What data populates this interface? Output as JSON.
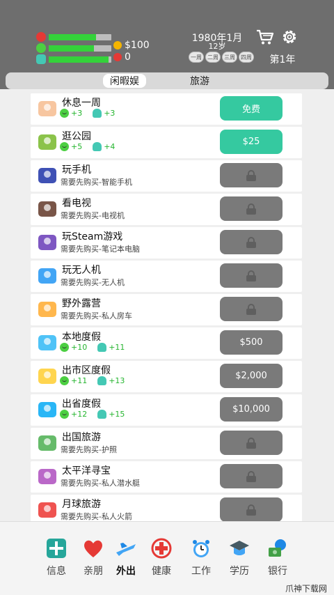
{
  "header": {
    "money": "$100",
    "karma": "0",
    "date": "1980年1月",
    "age": "12岁",
    "weeks": [
      "一周",
      "二周",
      "三周",
      "四周"
    ],
    "year": "第1年",
    "bars": {
      "health": 0.76,
      "happiness": 0.72,
      "smarts": 0.96
    },
    "icons": [
      "heart-icon",
      "face-icon",
      "head-icon",
      "cart-icon",
      "gear-icon",
      "coin-icon"
    ]
  },
  "tabs": [
    "闲暇娱",
    "旅游"
  ],
  "items": [
    {
      "title": "休息一周",
      "sub": "",
      "happy": "+3",
      "smart": "+3",
      "action": "免费",
      "state": "teal"
    },
    {
      "title": "逛公园",
      "sub": "",
      "happy": "+5",
      "smart": "+4",
      "action": "$25",
      "state": "teal"
    },
    {
      "title": "玩手机",
      "sub": "需要先购买-智能手机",
      "happy": "",
      "smart": "",
      "action": "",
      "state": "locked"
    },
    {
      "title": "看电视",
      "sub": "需要先购买-电视机",
      "happy": "",
      "smart": "",
      "action": "",
      "state": "locked"
    },
    {
      "title": "玩Steam游戏",
      "sub": "需要先购买-笔记本电脑",
      "happy": "",
      "smart": "",
      "action": "",
      "state": "locked"
    },
    {
      "title": "玩无人机",
      "sub": "需要先购买-无人机",
      "happy": "",
      "smart": "",
      "action": "",
      "state": "locked"
    },
    {
      "title": "野外露营",
      "sub": "需要先购买-私人房车",
      "happy": "",
      "smart": "",
      "action": "",
      "state": "locked"
    },
    {
      "title": "本地度假",
      "sub": "",
      "happy": "+10",
      "smart": "+11",
      "action": "$500",
      "state": "gray"
    },
    {
      "title": "出市区度假",
      "sub": "",
      "happy": "+11",
      "smart": "+13",
      "action": "$2,000",
      "state": "gray"
    },
    {
      "title": "出省度假",
      "sub": "",
      "happy": "+12",
      "smart": "+15",
      "action": "$10,000",
      "state": "gray"
    },
    {
      "title": "出国旅游",
      "sub": "需要先购买-护照",
      "happy": "",
      "smart": "",
      "action": "",
      "state": "locked"
    },
    {
      "title": "太平洋寻宝",
      "sub": "需要先购买-私人潜水艇",
      "happy": "",
      "smart": "",
      "action": "",
      "state": "locked"
    },
    {
      "title": "月球旅游",
      "sub": "需要先购买-私人火箭",
      "happy": "",
      "smart": "",
      "action": "",
      "state": "locked"
    }
  ],
  "nav": [
    "信息",
    "亲朋",
    "外出",
    "健康",
    "工作",
    "学历",
    "银行"
  ],
  "watermark": "爪神下载网",
  "colors": {
    "teal": "#35c9a0",
    "locked_gray": "#7a7a7a",
    "green": "#34d23a",
    "header": "#6e6e6e"
  }
}
